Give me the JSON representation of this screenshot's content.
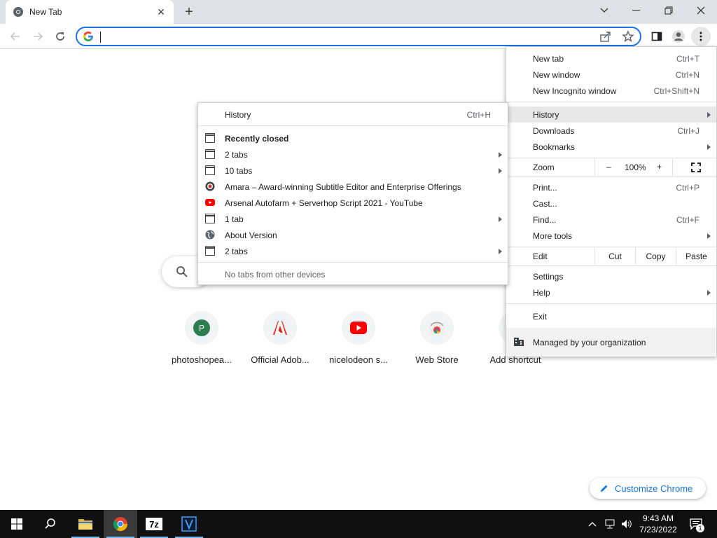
{
  "browser": {
    "tab_title": "New Tab",
    "omnibox_value": "",
    "omnibox_placeholder": ""
  },
  "ntp": {
    "shortcuts": [
      {
        "label": "photoshopea...",
        "icon": "photopea-icon",
        "initial": "P"
      },
      {
        "label": "Official Adob...",
        "icon": "adobe-icon"
      },
      {
        "label": "nicelodeon s...",
        "icon": "youtube-icon"
      },
      {
        "label": "Web Store",
        "icon": "web-store-icon"
      },
      {
        "label": "Add shortcut",
        "icon": "plus-icon"
      }
    ],
    "customize_label": "Customize Chrome"
  },
  "main_menu": {
    "new_tab": {
      "label": "New tab",
      "shortcut": "Ctrl+T"
    },
    "new_window": {
      "label": "New window",
      "shortcut": "Ctrl+N"
    },
    "new_incognito": {
      "label": "New Incognito window",
      "shortcut": "Ctrl+Shift+N"
    },
    "history": {
      "label": "History"
    },
    "downloads": {
      "label": "Downloads",
      "shortcut": "Ctrl+J"
    },
    "bookmarks": {
      "label": "Bookmarks"
    },
    "zoom": {
      "label": "Zoom",
      "minus": "–",
      "value": "100%",
      "plus": "+"
    },
    "print": {
      "label": "Print...",
      "shortcut": "Ctrl+P"
    },
    "cast": {
      "label": "Cast..."
    },
    "find": {
      "label": "Find...",
      "shortcut": "Ctrl+F"
    },
    "more_tools": {
      "label": "More tools"
    },
    "edit": {
      "label": "Edit",
      "cut": "Cut",
      "copy": "Copy",
      "paste": "Paste"
    },
    "settings": {
      "label": "Settings"
    },
    "help": {
      "label": "Help"
    },
    "exit": {
      "label": "Exit"
    },
    "managed": {
      "label": "Managed by your organization"
    }
  },
  "history_menu": {
    "history": {
      "label": "History",
      "shortcut": "Ctrl+H"
    },
    "recently_closed": "Recently closed",
    "items": [
      {
        "label": "2 tabs",
        "icon": "window-icon",
        "submenu": true
      },
      {
        "label": "10 tabs",
        "icon": "window-icon",
        "submenu": true
      },
      {
        "label": "Amara – Award-winning Subtitle Editor and Enterprise Offerings",
        "icon": "amara-icon",
        "submenu": false
      },
      {
        "label": "Arsenal Autofarm + Serverhop Script 2021 - YouTube",
        "icon": "youtube-icon",
        "submenu": false
      },
      {
        "label": "1 tab",
        "icon": "window-icon",
        "submenu": true
      },
      {
        "label": "About Version",
        "icon": "globe-icon",
        "submenu": false
      },
      {
        "label": "2 tabs",
        "icon": "window-icon",
        "submenu": true
      }
    ],
    "no_tabs": "No tabs from other devices"
  },
  "taskbar": {
    "time": "9:43 AM",
    "date": "7/23/2022",
    "notification_count": "1"
  }
}
